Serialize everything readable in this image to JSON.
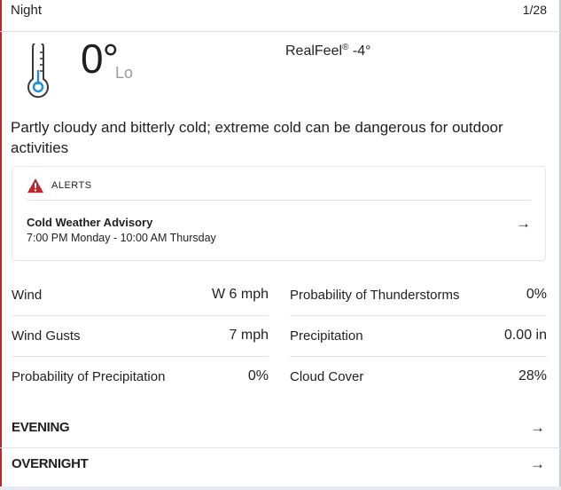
{
  "header": {
    "title": "Night",
    "date": "1/28"
  },
  "current": {
    "temp": "0°",
    "lo_label": "Lo",
    "realfeel_label": "RealFeel",
    "realfeel_mark": "®",
    "realfeel_value": "-4°",
    "phrase": "Partly cloudy and bitterly cold; extreme cold can be dangerous for outdoor activities"
  },
  "alerts": {
    "label": "ALERTS",
    "title": "Cold Weather Advisory",
    "time": "7:00 PM Monday - 10:00 AM Thursday",
    "arrow": "→"
  },
  "details": {
    "left": [
      {
        "label": "Wind",
        "value": "W 6 mph"
      },
      {
        "label": "Wind Gusts",
        "value": "7 mph"
      },
      {
        "label": "Probability of Precipitation",
        "value": "0%"
      }
    ],
    "right": [
      {
        "label": "Probability of Thunderstorms",
        "value": "0%"
      },
      {
        "label": "Precipitation",
        "value": "0.00 in"
      },
      {
        "label": "Cloud Cover",
        "value": "28%"
      }
    ]
  },
  "sections": [
    {
      "label": "EVENING",
      "arrow": "→"
    },
    {
      "label": "OVERNIGHT",
      "arrow": "→"
    }
  ],
  "colors": {
    "accent": "#c0272d",
    "thermo_blue": "#1d8fd6"
  },
  "icons": {
    "thermometer": "thermometer-icon",
    "warning": "warning-icon",
    "arrow": "arrow-right-icon"
  }
}
